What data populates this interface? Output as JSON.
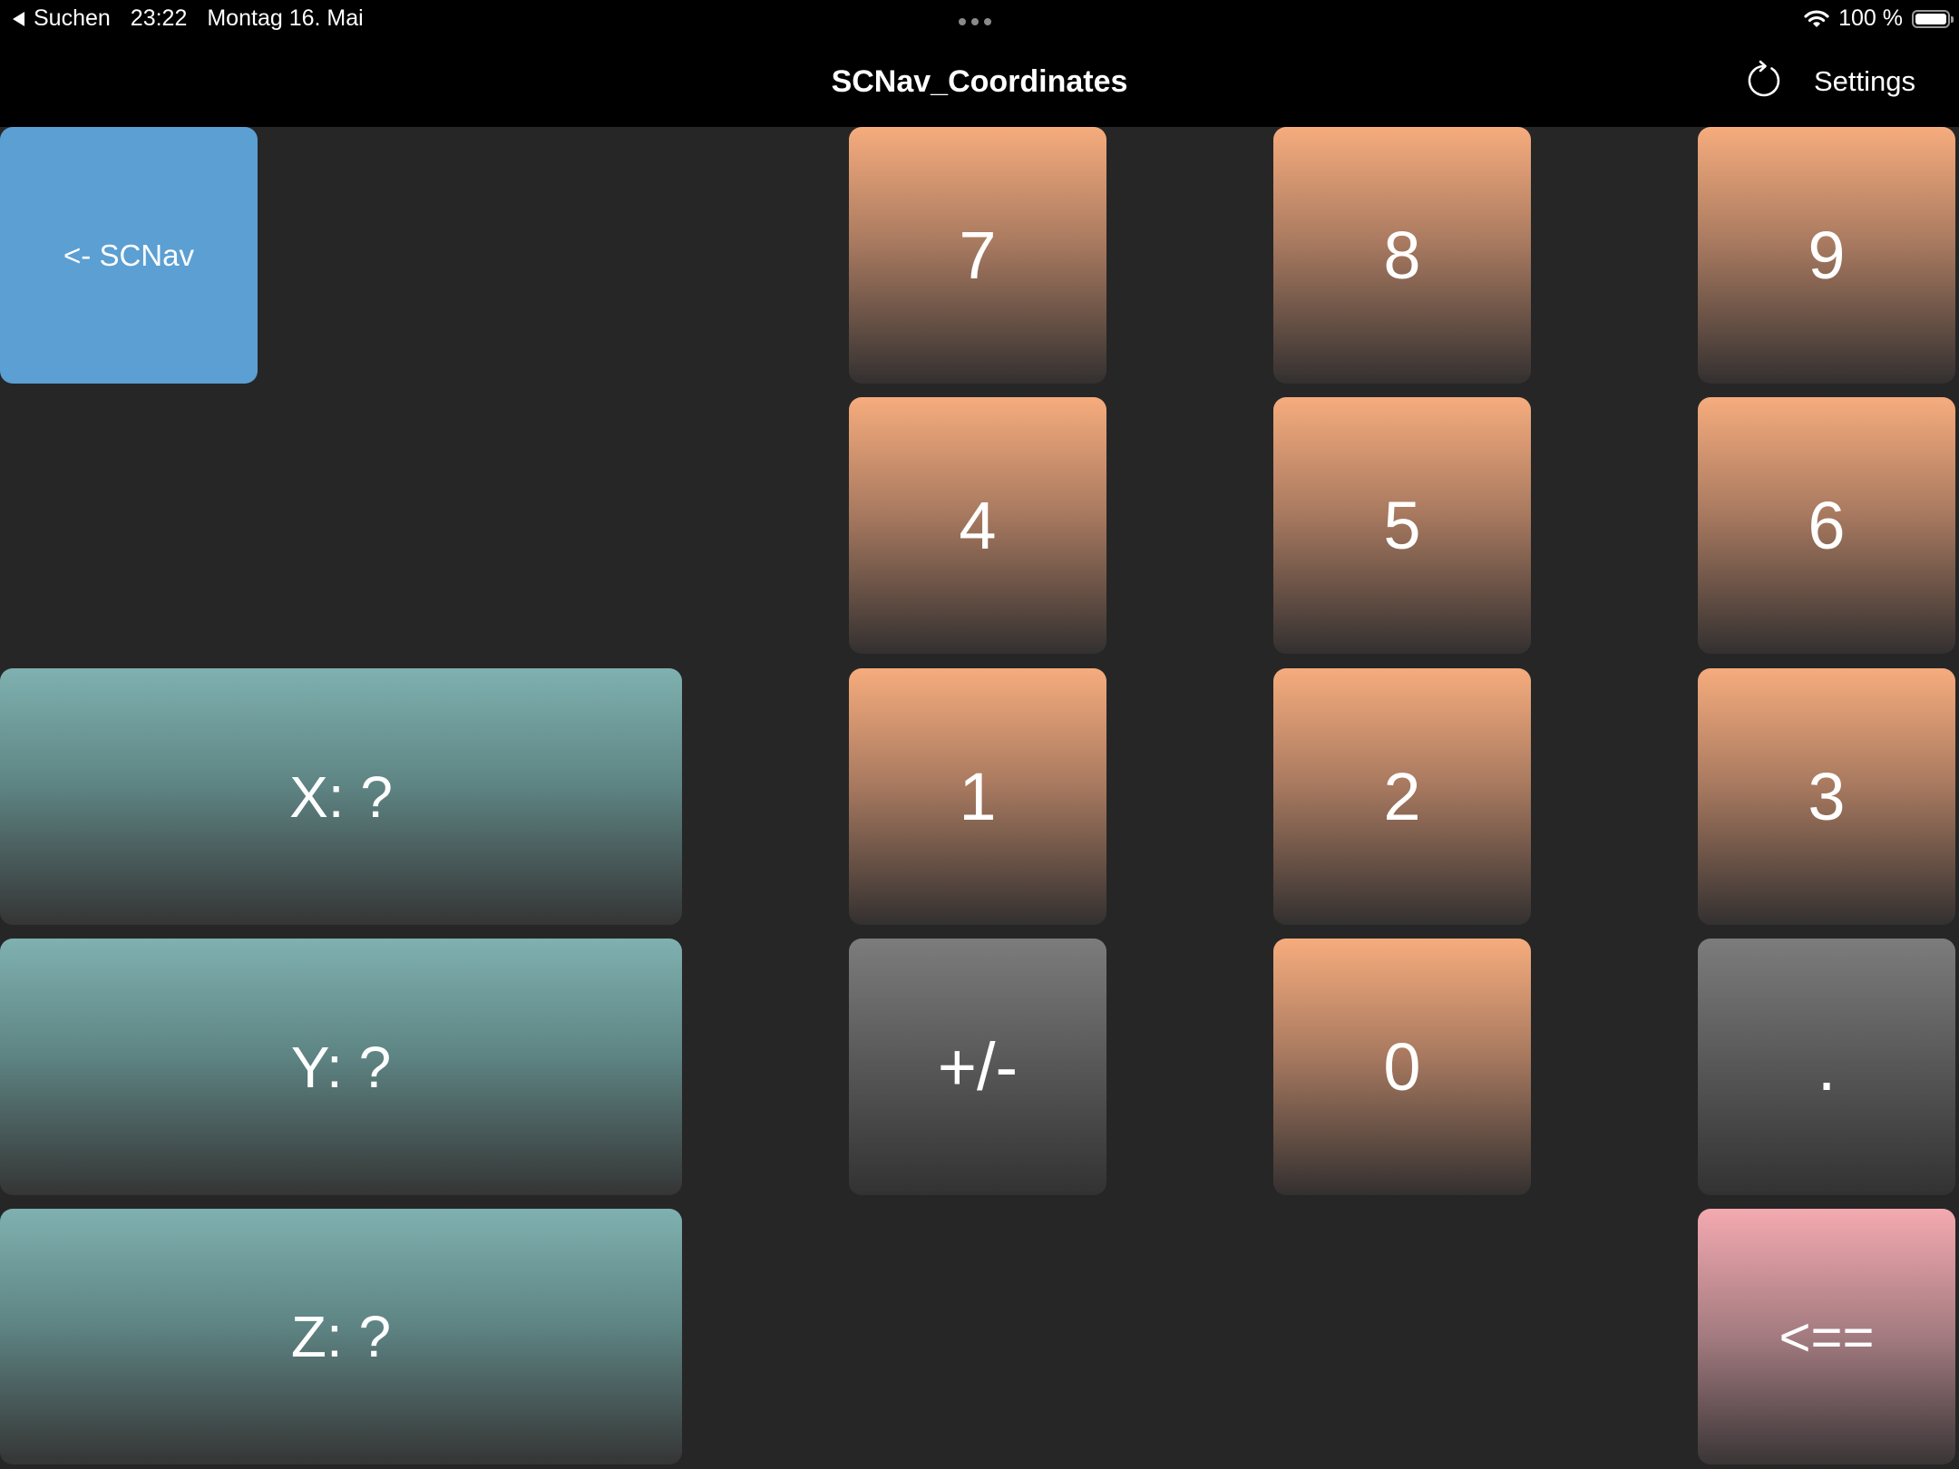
{
  "status_bar": {
    "back_label": "Suchen",
    "time": "23:22",
    "date": "Montag 16. Mai",
    "battery": "100 %"
  },
  "nav": {
    "title": "SCNav_Coordinates",
    "settings_label": "Settings",
    "refresh_icon": "refresh-icon"
  },
  "back_button": {
    "label": "<- SCNav"
  },
  "coordinates": {
    "x_label": "X: ?",
    "y_label": "Y: ?",
    "z_label": "Z: ?"
  },
  "keypad": {
    "k7": "7",
    "k8": "8",
    "k9": "9",
    "k4": "4",
    "k5": "5",
    "k6": "6",
    "k1": "1",
    "k2": "2",
    "k3": "3",
    "sign": "+/-",
    "k0": "0",
    "dot": ".",
    "backspace": "<=="
  },
  "colors": {
    "background": "#262626",
    "bar": "#000000",
    "digit_top": "#f6ac7d",
    "coord_top": "#7fb1b0",
    "back_button": "#5b9fd3",
    "backspace_top": "#f4a9b0",
    "function_top": "#7c7c7c"
  }
}
